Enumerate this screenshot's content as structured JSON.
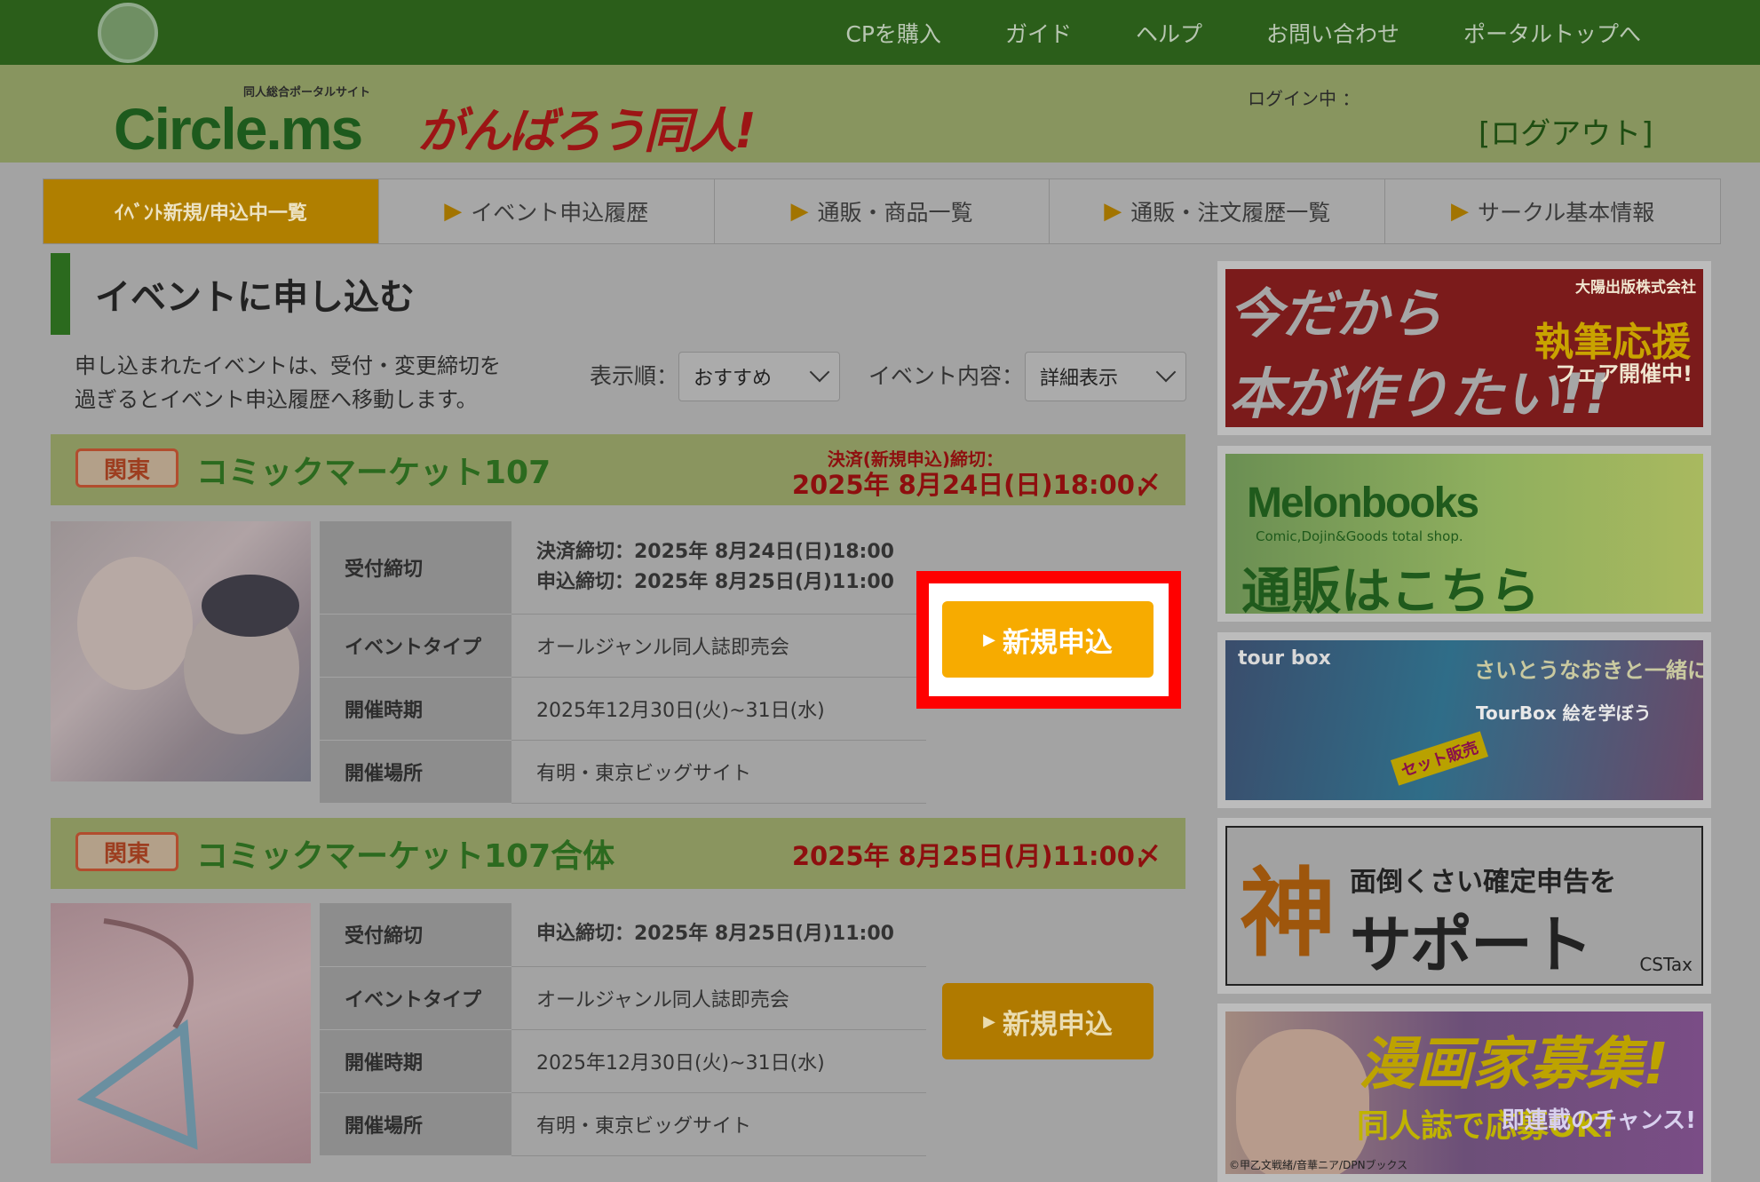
{
  "topnav": {
    "logo_alt": "",
    "items": [
      "CPを購入",
      "ガイド",
      "ヘルプ",
      "お問い合わせ",
      "ポータルトップへ"
    ]
  },
  "header": {
    "logo_sub": "同人総合ポータルサイト",
    "logo_main": "Circle.ms",
    "logo_campaign": "がんばろう同人!",
    "login_label": "ログイン中 ：",
    "logout_label": "[ログアウト]"
  },
  "tabs": [
    {
      "label": "ｲﾍﾞﾝﾄ新規/申込中一覧",
      "active": true
    },
    {
      "label": "イベント申込履歴",
      "active": false
    },
    {
      "label": "通販・商品一覧",
      "active": false
    },
    {
      "label": "通販・注文履歴一覧",
      "active": false
    },
    {
      "label": "サークル基本情報",
      "active": false
    }
  ],
  "page": {
    "title": "イベントに申し込む",
    "notice_line1": "申し込まれたイベントは、受付・変更締切を",
    "notice_line2": "過ぎるとイベント申込履歴へ移動します。",
    "sort_label": "表示順：",
    "sort_value": "おすすめ",
    "content_label": "イベント内容：",
    "content_value": "詳細表示"
  },
  "events": [
    {
      "region": "関東",
      "title": "コミックマーケット107",
      "deadline_label": "決済(新規申込)締切：",
      "deadline_date": "2025年 8月24日(日)18:00〆",
      "rows": [
        {
          "key": "受付締切",
          "value_line1": "決済締切：2025年 8月24日(日)18:00",
          "value_line2": "申込締切：2025年 8月25日(月)11:00"
        },
        {
          "key": "イベントタイプ",
          "value": "オールジャンル同人誌即売会"
        },
        {
          "key": "開催時期",
          "value": "2025年12月30日(火)~31日(水)"
        },
        {
          "key": "開催場所",
          "value": "有明・東京ビッグサイト"
        }
      ],
      "apply_label": "新規申込"
    },
    {
      "region": "関東",
      "title": "コミックマーケット107合体",
      "deadline_label": "",
      "deadline_date": "2025年 8月25日(月)11:00〆",
      "rows": [
        {
          "key": "受付締切",
          "value_line1": "申込締切：2025年 8月25日(月)11:00"
        },
        {
          "key": "イベントタイプ",
          "value": "オールジャンル同人誌即売会"
        },
        {
          "key": "開催時期",
          "value": "2025年12月30日(火)~31日(水)"
        },
        {
          "key": "開催場所",
          "value": "有明・東京ビッグサイト"
        }
      ],
      "apply_label": "新規申込"
    }
  ],
  "ads": {
    "ad1": {
      "line1": "今だから",
      "line2": "本が作りたい!!",
      "publisher": "大陽出版株式会社",
      "fair": "執筆応援",
      "fair2": "フェア開催中!"
    },
    "ad2": {
      "brand": "Melonbooks",
      "sub": "Comic,Dojin&Goods total shop.",
      "cta": "通販はこちら"
    },
    "ad3": {
      "brand": "tour box",
      "title": "さいとうなおきと一緒に",
      "sub": "TourBox 絵を学ぼう",
      "badge": "セット販売"
    },
    "ad4": {
      "kanji": "神",
      "line1": "面倒くさい確定申告を",
      "line2": "サポート",
      "brand": "CSTax"
    },
    "ad5": {
      "title": "漫画家募集!",
      "sub": "同人誌で応募OK!",
      "sub2": "即連載のチャンス!",
      "copyright": "©甲乙文戦緒/音華ニア/DPNブックス"
    }
  },
  "colors": {
    "topbar": "#2b5e1a",
    "header": "#88955f",
    "tab_active": "#b07f00",
    "apply_button": "#f7ab00",
    "highlight_frame": "#ff0000"
  }
}
